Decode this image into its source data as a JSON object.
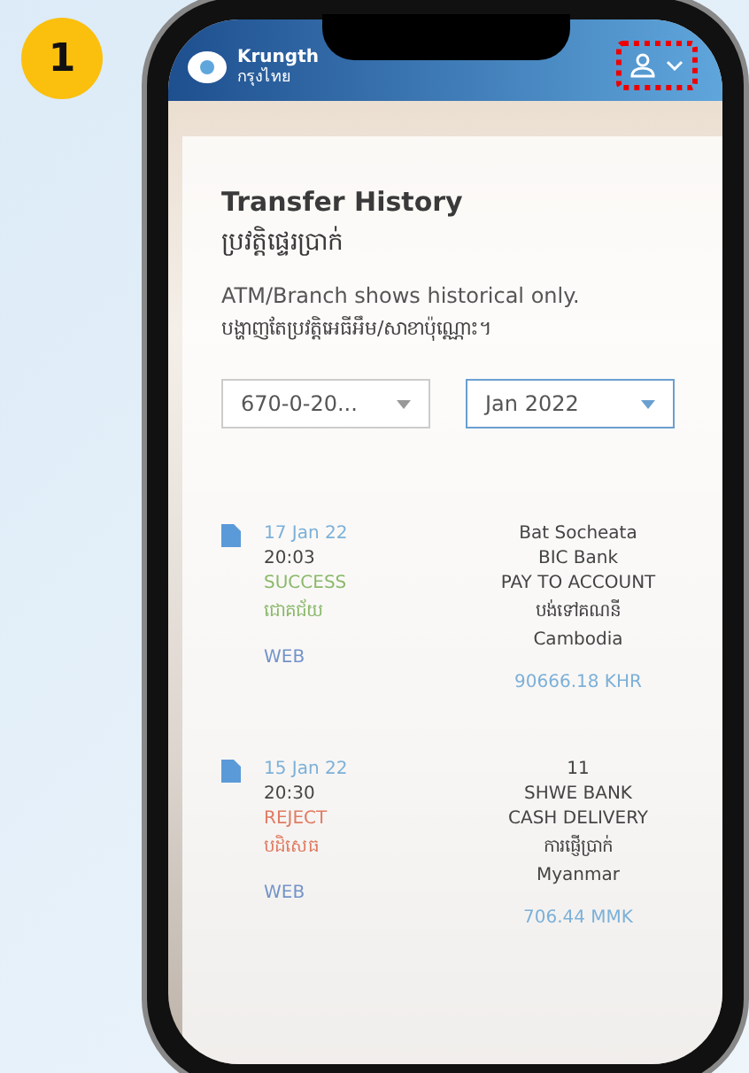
{
  "step_badge": "1",
  "header": {
    "brand": "Krungth",
    "brand_sub": "กรุงไทย",
    "user_highlighted": true
  },
  "title": "Transfer History",
  "title_km": "ប្រវត្តិផ្ទេរប្រាក់",
  "note": "ATM/Branch shows historical only.",
  "note_km": "បង្ហាញតែប្រវត្តិអេធីអឹម/សាខាប៉ុណ្ណោះ។",
  "filters": [
    {
      "value": "670-0-20...",
      "focused": false
    },
    {
      "value": "Jan 2022",
      "focused": true
    }
  ],
  "transactions": [
    {
      "date": "17 Jan 22",
      "time": "20:03",
      "status": "SUCCESS",
      "status_km": "ជោគជ័យ",
      "kind": "success",
      "channel": "WEB",
      "recipient": "Bat Socheata",
      "bank": "BIC Bank",
      "method": "PAY TO ACCOUNT",
      "method_km": "បង់ទៅគណនី",
      "country": "Cambodia",
      "amount": "90666.18 KHR"
    },
    {
      "date": "15 Jan 22",
      "time": "20:30",
      "status": "REJECT",
      "status_km": "បដិសេធ",
      "kind": "reject",
      "channel": "WEB",
      "recipient": "11",
      "bank": "SHWE BANK",
      "method": "CASH DELIVERY",
      "method_km": "ការផ្ញើប្រាក់",
      "country": "Myanmar",
      "amount": "706.44 MMK"
    }
  ]
}
